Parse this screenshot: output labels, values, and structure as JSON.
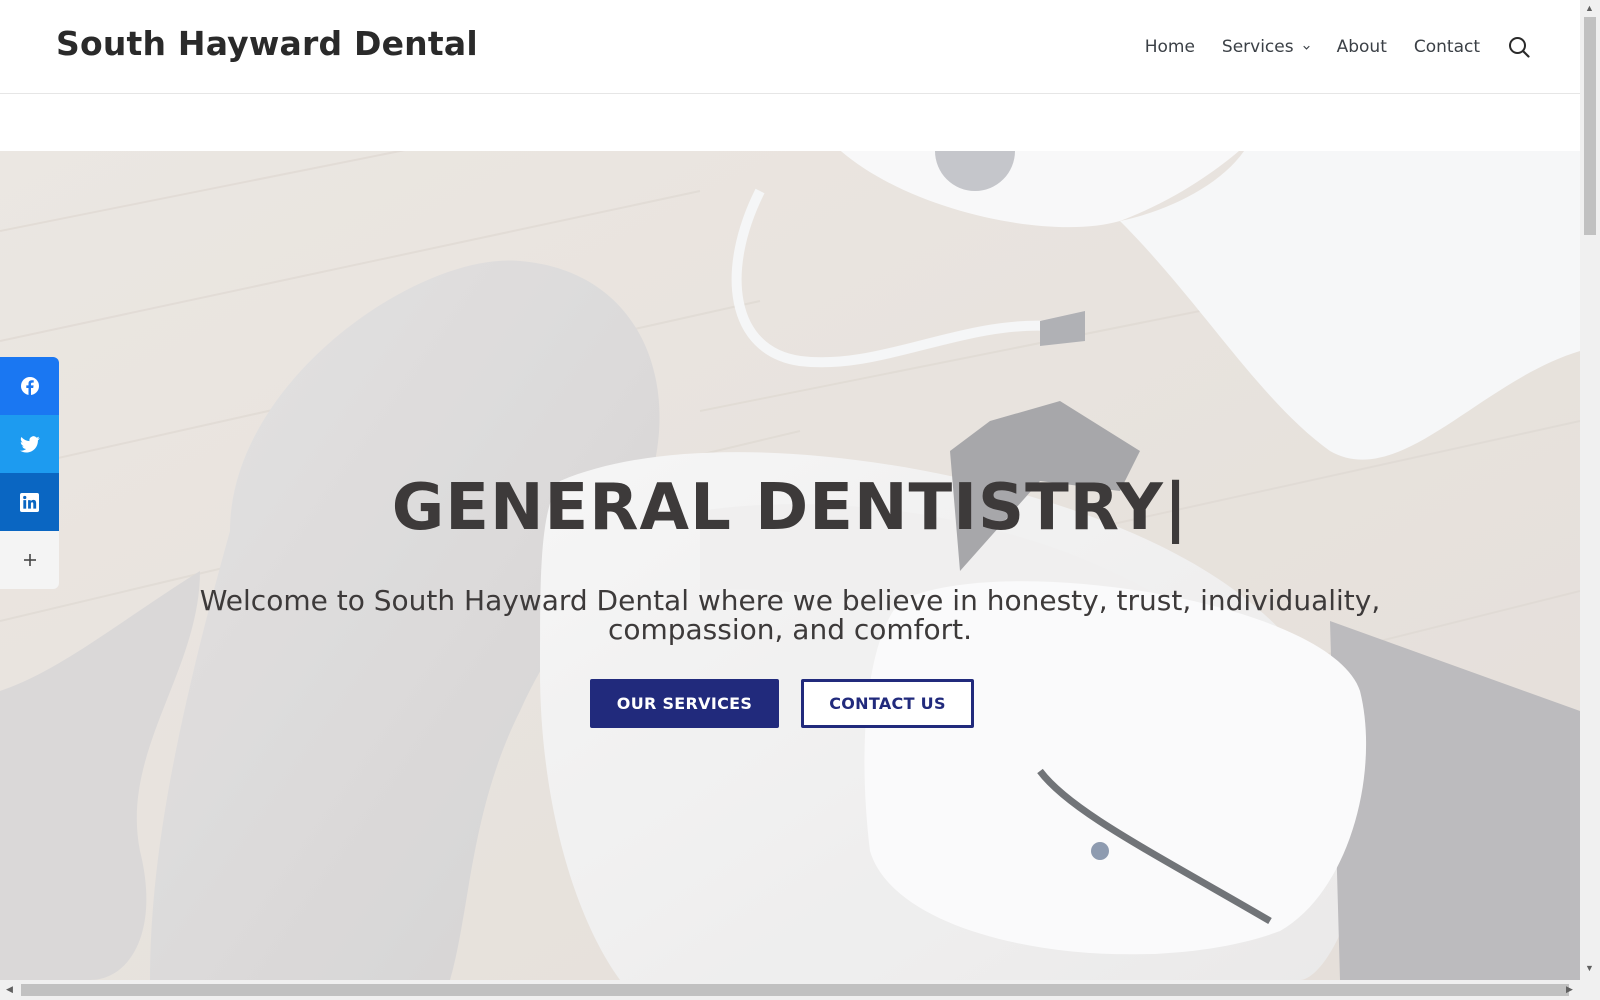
{
  "header": {
    "site_title": "South Hayward Dental",
    "nav": [
      {
        "label": "Home"
      },
      {
        "label": "Services",
        "has_dropdown": true
      },
      {
        "label": "About"
      },
      {
        "label": "Contact"
      }
    ],
    "search_icon": "search-icon"
  },
  "hero": {
    "title": "GENERAL DENTISTRY|",
    "text": "Welcome to South Hayward Dental where we believe in honesty, trust, individuality, compassion, and comfort.",
    "primary_button": "OUR SERVICES",
    "secondary_button": "CONTACT US"
  },
  "share_bar": {
    "items": [
      {
        "icon": "facebook-icon",
        "color": "#1a77f2"
      },
      {
        "icon": "twitter-icon",
        "color": "#1d9bf0"
      },
      {
        "icon": "linkedin-icon",
        "color": "#0a66c2"
      },
      {
        "icon": "plus-icon",
        "color": "#f4f4f4"
      }
    ]
  },
  "colors": {
    "brand_primary": "#212a7c",
    "title_text": "#3d3a3a"
  }
}
